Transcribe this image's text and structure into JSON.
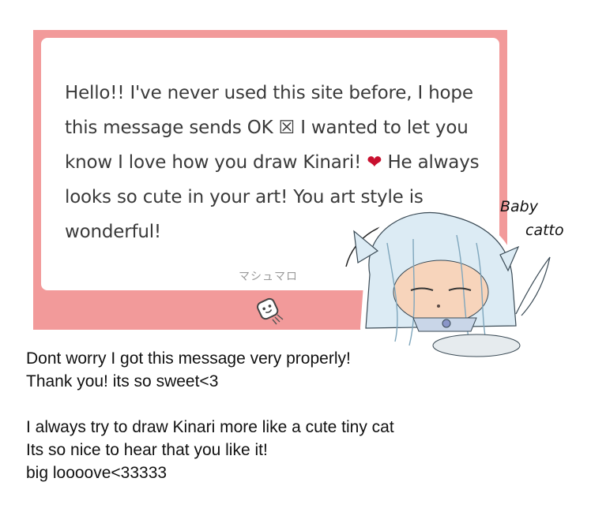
{
  "card": {
    "message_part1": "Hello!! I've never used this site before, I hope this message sends OK ",
    "box_glyph": "☒",
    "message_part2": " I wanted to let you know I love how you draw Kinari! ",
    "heart": "❤",
    "message_part3": " He always looks so cute in your art! You art style is wonderful!",
    "brand": "マシュマロ",
    "logo_icon": "marshmallow-icon",
    "frame_color": "#f29a9a"
  },
  "illustration": {
    "handwriting_line1": "Baby",
    "handwriting_line2": "catto"
  },
  "reply": {
    "lines": [
      "Dont worry I got this message very properly!",
      "Thank you! its so sweet<3",
      "",
      "I always try to draw Kinari more like a cute tiny cat",
      "Its so nice to hear that you like it!",
      "big loooove<33333"
    ]
  }
}
